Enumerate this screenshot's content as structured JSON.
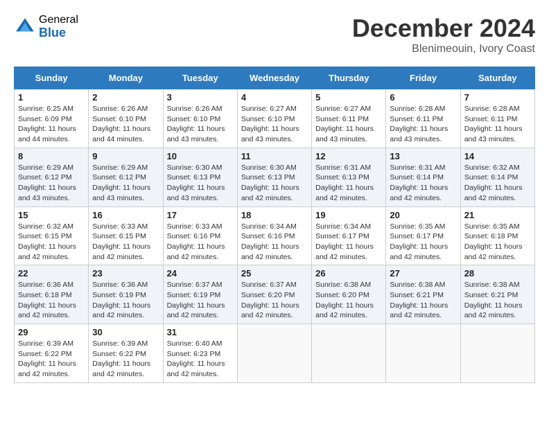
{
  "logo": {
    "general": "General",
    "blue": "Blue"
  },
  "title": {
    "month": "December 2024",
    "location": "Blenimeouin, Ivory Coast"
  },
  "headers": [
    "Sunday",
    "Monday",
    "Tuesday",
    "Wednesday",
    "Thursday",
    "Friday",
    "Saturday"
  ],
  "weeks": [
    [
      {
        "day": "1",
        "sunrise": "6:25 AM",
        "sunset": "6:09 PM",
        "daylight": "11 hours and 44 minutes."
      },
      {
        "day": "2",
        "sunrise": "6:26 AM",
        "sunset": "6:10 PM",
        "daylight": "11 hours and 44 minutes."
      },
      {
        "day": "3",
        "sunrise": "6:26 AM",
        "sunset": "6:10 PM",
        "daylight": "11 hours and 43 minutes."
      },
      {
        "day": "4",
        "sunrise": "6:27 AM",
        "sunset": "6:10 PM",
        "daylight": "11 hours and 43 minutes."
      },
      {
        "day": "5",
        "sunrise": "6:27 AM",
        "sunset": "6:11 PM",
        "daylight": "11 hours and 43 minutes."
      },
      {
        "day": "6",
        "sunrise": "6:28 AM",
        "sunset": "6:11 PM",
        "daylight": "11 hours and 43 minutes."
      },
      {
        "day": "7",
        "sunrise": "6:28 AM",
        "sunset": "6:11 PM",
        "daylight": "11 hours and 43 minutes."
      }
    ],
    [
      {
        "day": "8",
        "sunrise": "6:29 AM",
        "sunset": "6:12 PM",
        "daylight": "11 hours and 43 minutes."
      },
      {
        "day": "9",
        "sunrise": "6:29 AM",
        "sunset": "6:12 PM",
        "daylight": "11 hours and 43 minutes."
      },
      {
        "day": "10",
        "sunrise": "6:30 AM",
        "sunset": "6:13 PM",
        "daylight": "11 hours and 43 minutes."
      },
      {
        "day": "11",
        "sunrise": "6:30 AM",
        "sunset": "6:13 PM",
        "daylight": "11 hours and 42 minutes."
      },
      {
        "day": "12",
        "sunrise": "6:31 AM",
        "sunset": "6:13 PM",
        "daylight": "11 hours and 42 minutes."
      },
      {
        "day": "13",
        "sunrise": "6:31 AM",
        "sunset": "6:14 PM",
        "daylight": "11 hours and 42 minutes."
      },
      {
        "day": "14",
        "sunrise": "6:32 AM",
        "sunset": "6:14 PM",
        "daylight": "11 hours and 42 minutes."
      }
    ],
    [
      {
        "day": "15",
        "sunrise": "6:32 AM",
        "sunset": "6:15 PM",
        "daylight": "11 hours and 42 minutes."
      },
      {
        "day": "16",
        "sunrise": "6:33 AM",
        "sunset": "6:15 PM",
        "daylight": "11 hours and 42 minutes."
      },
      {
        "day": "17",
        "sunrise": "6:33 AM",
        "sunset": "6:16 PM",
        "daylight": "11 hours and 42 minutes."
      },
      {
        "day": "18",
        "sunrise": "6:34 AM",
        "sunset": "6:16 PM",
        "daylight": "11 hours and 42 minutes."
      },
      {
        "day": "19",
        "sunrise": "6:34 AM",
        "sunset": "6:17 PM",
        "daylight": "11 hours and 42 minutes."
      },
      {
        "day": "20",
        "sunrise": "6:35 AM",
        "sunset": "6:17 PM",
        "daylight": "11 hours and 42 minutes."
      },
      {
        "day": "21",
        "sunrise": "6:35 AM",
        "sunset": "6:18 PM",
        "daylight": "11 hours and 42 minutes."
      }
    ],
    [
      {
        "day": "22",
        "sunrise": "6:36 AM",
        "sunset": "6:18 PM",
        "daylight": "11 hours and 42 minutes."
      },
      {
        "day": "23",
        "sunrise": "6:36 AM",
        "sunset": "6:19 PM",
        "daylight": "11 hours and 42 minutes."
      },
      {
        "day": "24",
        "sunrise": "6:37 AM",
        "sunset": "6:19 PM",
        "daylight": "11 hours and 42 minutes."
      },
      {
        "day": "25",
        "sunrise": "6:37 AM",
        "sunset": "6:20 PM",
        "daylight": "11 hours and 42 minutes."
      },
      {
        "day": "26",
        "sunrise": "6:38 AM",
        "sunset": "6:20 PM",
        "daylight": "11 hours and 42 minutes."
      },
      {
        "day": "27",
        "sunrise": "6:38 AM",
        "sunset": "6:21 PM",
        "daylight": "11 hours and 42 minutes."
      },
      {
        "day": "28",
        "sunrise": "6:38 AM",
        "sunset": "6:21 PM",
        "daylight": "11 hours and 42 minutes."
      }
    ],
    [
      {
        "day": "29",
        "sunrise": "6:39 AM",
        "sunset": "6:22 PM",
        "daylight": "11 hours and 42 minutes."
      },
      {
        "day": "30",
        "sunrise": "6:39 AM",
        "sunset": "6:22 PM",
        "daylight": "11 hours and 42 minutes."
      },
      {
        "day": "31",
        "sunrise": "6:40 AM",
        "sunset": "6:23 PM",
        "daylight": "11 hours and 42 minutes."
      },
      null,
      null,
      null,
      null
    ]
  ]
}
